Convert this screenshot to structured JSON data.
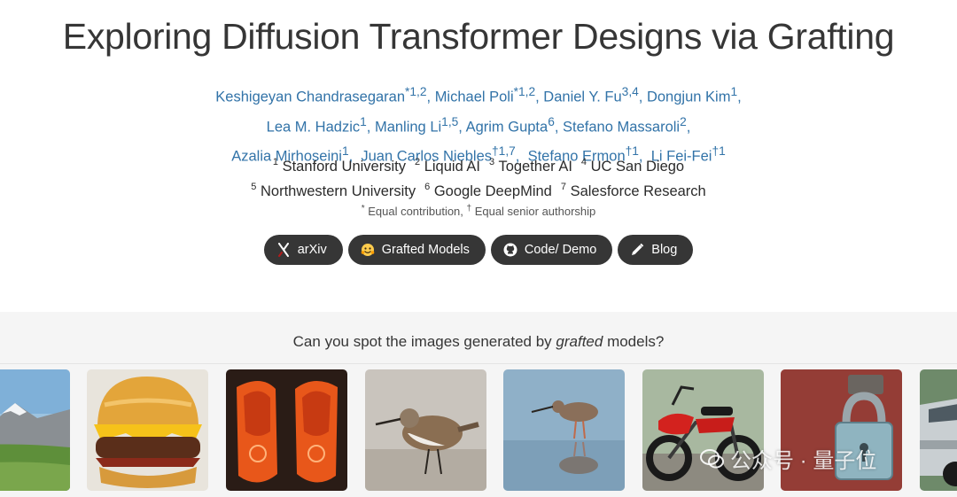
{
  "title": "Exploring Diffusion Transformer Designs via Grafting",
  "authors": [
    [
      {
        "name": "Keshigeyan Chandrasegaran",
        "sup": "*1,2",
        "sep": ", "
      },
      {
        "name": "Michael Poli",
        "sup": "*1,2",
        "sep": ", "
      },
      {
        "name": "Daniel Y. Fu",
        "sup": "3,4",
        "sep": ", "
      },
      {
        "name": "Dongjun Kim",
        "sup": "1",
        "sep": ","
      }
    ],
    [
      {
        "name": "Lea M. Hadzic",
        "sup": "1",
        "sep": ", "
      },
      {
        "name": "Manling Li",
        "sup": "1,5",
        "sep": ", "
      },
      {
        "name": "Agrim Gupta",
        "sup": "6",
        "sep": ", "
      },
      {
        "name": "Stefano Massaroli",
        "sup": "2",
        "sep": ","
      }
    ],
    [
      {
        "name": "Azalia Mirhoseini",
        "sup": "1",
        "sep": ",  "
      },
      {
        "name": "Juan Carlos Niebles",
        "sup": "†1,7",
        "sep": ",  "
      },
      {
        "name": "Stefano Ermon",
        "sup": "†1",
        "sep": ",  "
      },
      {
        "name": "Li Fei-Fei",
        "sup": "†1",
        "sep": ""
      }
    ]
  ],
  "affiliations": [
    [
      {
        "num": "1",
        "name": "Stanford University"
      },
      {
        "num": "2",
        "name": "Liquid AI"
      },
      {
        "num": "3",
        "name": "Together AI"
      },
      {
        "num": "4",
        "name": "UC San Diego"
      }
    ],
    [
      {
        "num": "5",
        "name": "Northwestern University"
      },
      {
        "num": "6",
        "name": "Google DeepMind"
      },
      {
        "num": "7",
        "name": "Salesforce Research"
      }
    ]
  ],
  "note": {
    "equal_mark": "*",
    "equal_text": " Equal contribution, ",
    "senior_mark": "†",
    "senior_text": " Equal senior authorship"
  },
  "buttons": [
    {
      "label": "arXiv",
      "icon": "arxiv-icon"
    },
    {
      "label": "Grafted Models",
      "icon": "hugging-face-icon"
    },
    {
      "label": "Code/ Demo",
      "icon": "github-icon"
    },
    {
      "label": "Blog",
      "icon": "pencil-icon"
    }
  ],
  "gallery": {
    "question_before": "Can you spot the images generated by ",
    "question_em": "grafted",
    "question_after": " models?"
  },
  "watermark": {
    "text": "公众号 · 量子位"
  }
}
